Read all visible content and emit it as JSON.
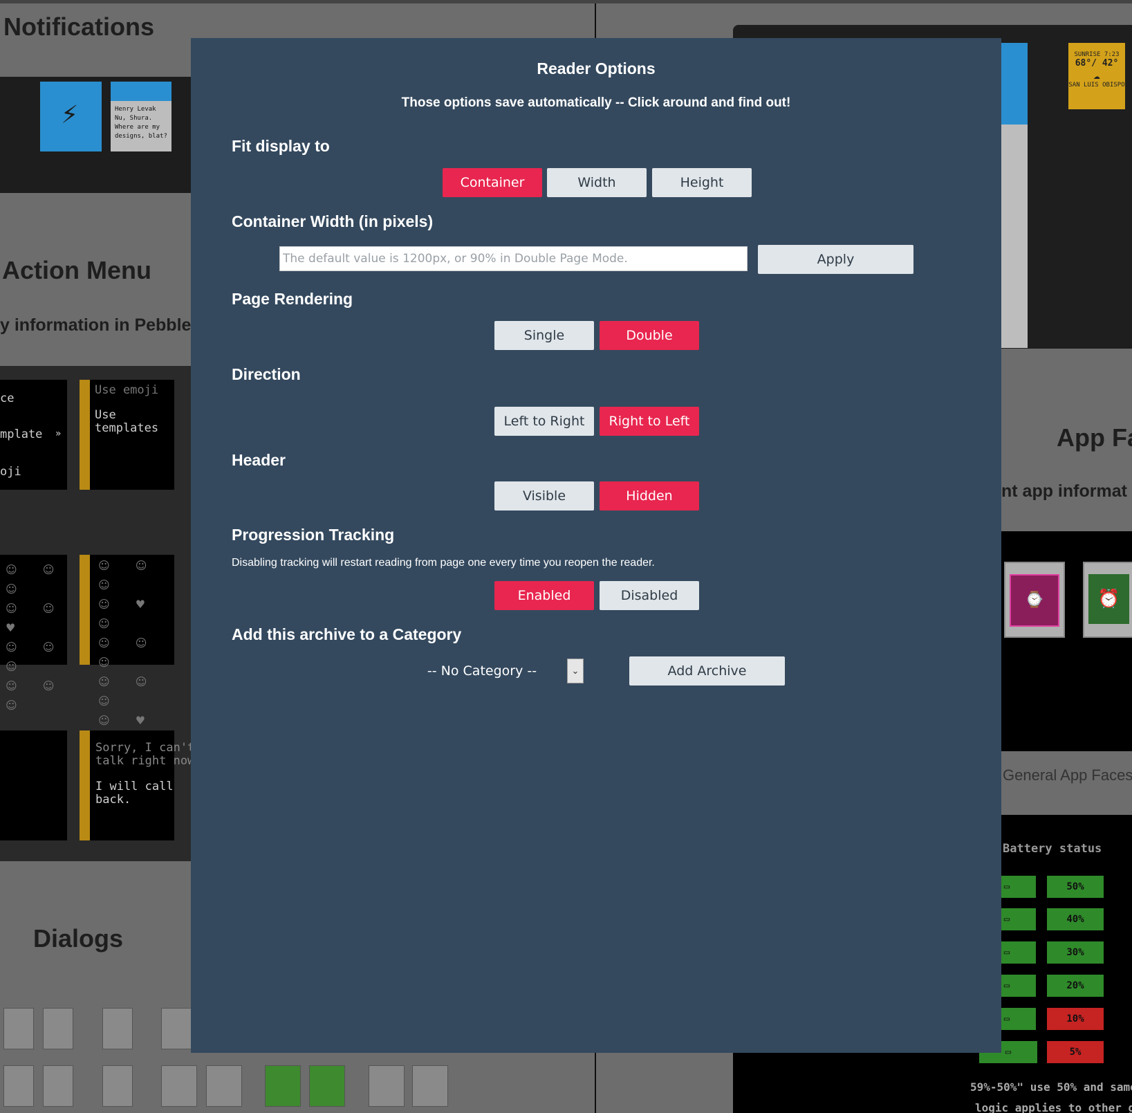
{
  "background": {
    "headings": {
      "notifications": "Notifications",
      "action_menu": "Action Menu",
      "action_menu_sub": "y information in Pebble",
      "dialogs": "Dialogs",
      "app_faces": "App Fa",
      "app_faces_sub": "nt app informat",
      "general_app_faces": "General App Faces",
      "battery_status": "Battery status",
      "battery_note_1": "59%-50%\" use 50% and same",
      "battery_note_2": "logic applies to other groups"
    },
    "watch_texts": {
      "use_emoji": "Use emoji",
      "use_templates": "Use\ntemplates",
      "template_left": "mplate",
      "ce_left": "ce",
      "oji_left": "oji",
      "sorry": "Sorry, I can't\ntalk right now.",
      "will_call": "I will call\nback.",
      "notif_text": "Henry Levak\nNu, Shura.\nWhere are my\ndesigns, blat?",
      "weather_sunrise": "SUNRISE 7:23",
      "weather_temp": "68°/ 42°",
      "weather_city": "SAN LUIS OBISPO"
    },
    "battery_levels_right": [
      "50%",
      "40%",
      "30%",
      "20%",
      "10%",
      "5%"
    ]
  },
  "modal": {
    "title": "Reader Options",
    "subtitle": "Those options save automatically -- Click around and find out!",
    "fit_display": {
      "heading": "Fit display to",
      "options": [
        "Container",
        "Width",
        "Height"
      ],
      "selected": "Container"
    },
    "container_width": {
      "heading": "Container Width (in pixels)",
      "placeholder": "The default value is 1200px, or 90% in Double Page Mode.",
      "value": "",
      "apply_label": "Apply"
    },
    "page_rendering": {
      "heading": "Page Rendering",
      "options": [
        "Single",
        "Double"
      ],
      "selected": "Double"
    },
    "direction": {
      "heading": "Direction",
      "options": [
        "Left to Right",
        "Right to Left"
      ],
      "selected": "Right to Left"
    },
    "header": {
      "heading": "Header",
      "options": [
        "Visible",
        "Hidden"
      ],
      "selected": "Hidden"
    },
    "progression": {
      "heading": "Progression Tracking",
      "description": "Disabling tracking will restart reading from page one every time you reopen the reader.",
      "options": [
        "Enabled",
        "Disabled"
      ],
      "selected": "Enabled"
    },
    "category": {
      "heading": "Add this archive to a Category",
      "selected": "-- No Category --",
      "add_label": "Add Archive"
    },
    "colors": {
      "background": "#34495e",
      "accent": "#e8264f",
      "button": "#e1e6ea"
    }
  }
}
